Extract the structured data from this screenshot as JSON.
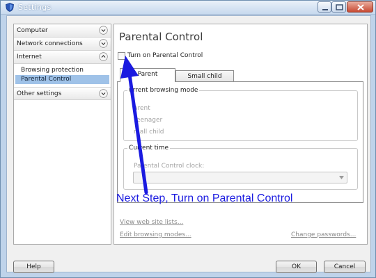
{
  "window": {
    "title": "Settings",
    "controls": {
      "minimize": "minimize-icon",
      "maximize": "maximize-icon",
      "close": "close-icon"
    }
  },
  "sidebar": {
    "sections": [
      {
        "label": "Computer",
        "expanded": false,
        "icon": "chevron-down-icon"
      },
      {
        "label": "Network connections",
        "expanded": false,
        "icon": "chevron-down-icon"
      },
      {
        "label": "Internet",
        "expanded": true,
        "icon": "chevron-up-icon",
        "items": [
          {
            "label": "Browsing protection",
            "selected": false
          },
          {
            "label": "Parental Control",
            "selected": true
          }
        ]
      },
      {
        "label": "Other settings",
        "expanded": false,
        "icon": "chevron-down-icon"
      }
    ]
  },
  "main": {
    "title": "Parental Control",
    "enable_checkbox": {
      "label": "Turn on Parental Control",
      "checked": false
    },
    "tabs": [
      {
        "label": "Parent",
        "active": true
      },
      {
        "label": "Small child",
        "active": false
      }
    ],
    "browsing_mode": {
      "legend": "urrent browsing mode",
      "options": [
        "arent",
        "Teenager",
        "mall child"
      ]
    },
    "current_time": {
      "legend": "Current time",
      "clock_label": "Parental Control clock:",
      "clock_value": ""
    },
    "links": {
      "view_lists": "View web site lists...",
      "edit_modes": "Edit browsing modes...",
      "change_passwords": "Change passwords..."
    }
  },
  "annotation": {
    "text": "Next Step, Turn on Parental Control",
    "color": "#1a1ae0"
  },
  "footer": {
    "help": "Help",
    "ok": "OK",
    "cancel": "Cancel"
  }
}
